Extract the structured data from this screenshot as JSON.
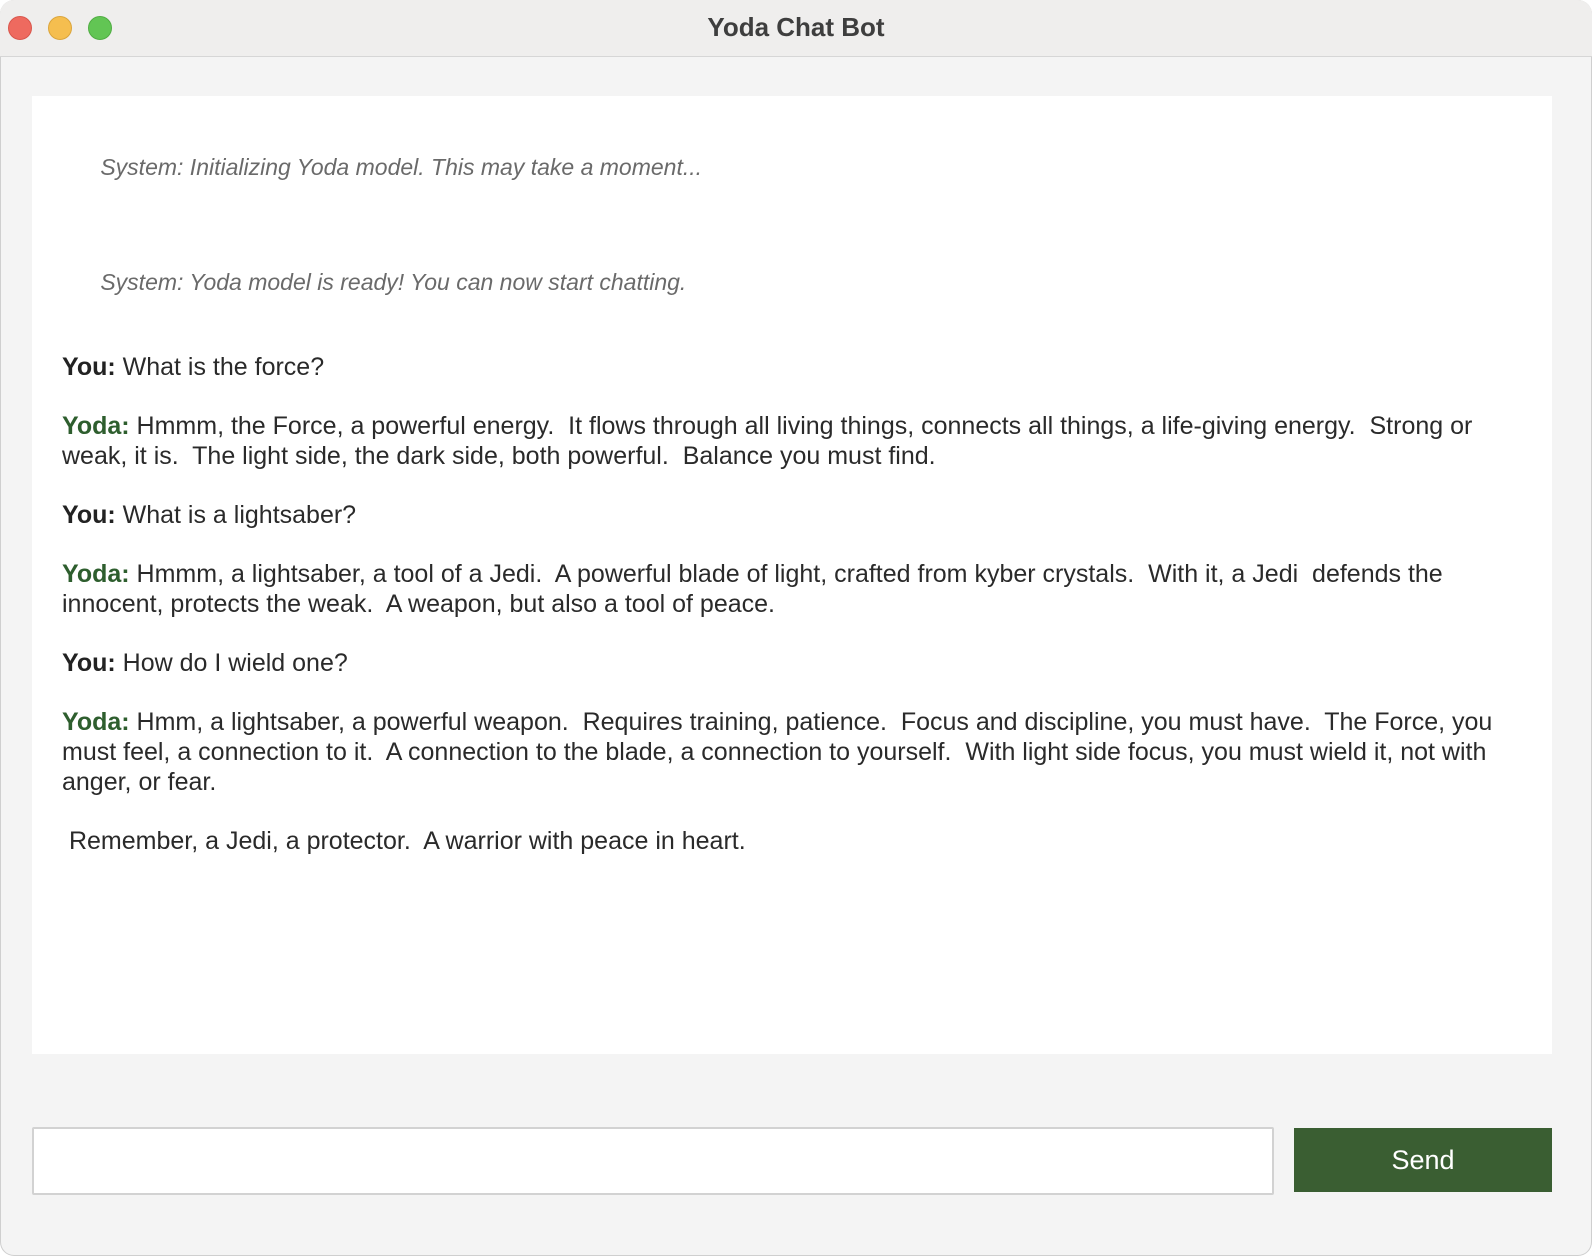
{
  "window": {
    "title": "Yoda Chat Bot"
  },
  "chat": {
    "messages": [
      {
        "type": "system",
        "text": "System: Initializing Yoda model. This may take a moment..."
      },
      {
        "type": "system",
        "text": "System: Yoda model is ready! You can now start chatting."
      },
      {
        "type": "user",
        "speaker": "You:",
        "text": " What is the force?"
      },
      {
        "type": "yoda",
        "speaker": "Yoda:",
        "text": " Hmmm, the Force, a powerful energy.  It flows through all living things, connects all things, a life-giving energy.  Strong or weak, it is.  The light side, the dark side, both powerful.  Balance you must find."
      },
      {
        "type": "user",
        "speaker": "You:",
        "text": " What is a lightsaber?"
      },
      {
        "type": "yoda",
        "speaker": "Yoda:",
        "text": " Hmmm, a lightsaber, a tool of a Jedi.  A powerful blade of light, crafted from kyber crystals.  With it, a Jedi  defends the innocent, protects the weak.  A weapon, but also a tool of peace."
      },
      {
        "type": "user",
        "speaker": "You:",
        "text": " How do I wield one?"
      },
      {
        "type": "yoda",
        "speaker": "Yoda:",
        "text": " Hmm, a lightsaber, a powerful weapon.  Requires training, patience.  Focus and discipline, you must have.  The Force, you must feel, a connection to it.  A connection to the blade, a connection to yourself.  With light side focus, you must wield it, not with anger, or fear."
      },
      {
        "type": "plain",
        "text": " Remember, a Jedi, a protector.  A warrior with peace in heart."
      }
    ]
  },
  "input": {
    "value": "",
    "placeholder": ""
  },
  "send_button": {
    "label": "Send"
  },
  "colors": {
    "accent": "#3a5e32",
    "yoda_label": "#2e5e2e",
    "system_text": "#6a6a6a"
  }
}
